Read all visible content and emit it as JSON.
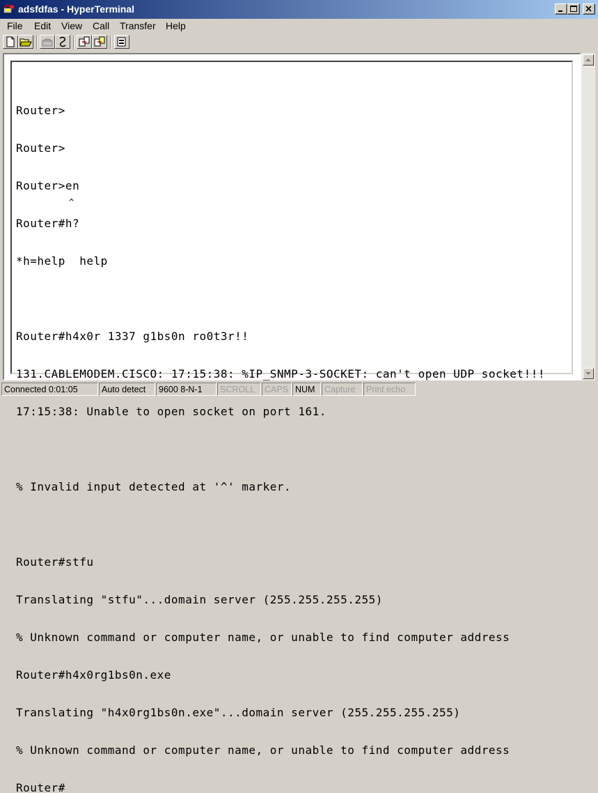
{
  "window": {
    "title": "adsfdfas - HyperTerminal",
    "accent_color": "#0a246a",
    "buttons": [
      "minimize-icon",
      "restore-icon",
      "close-icon"
    ]
  },
  "menu": [
    "File",
    "Edit",
    "View",
    "Call",
    "Transfer",
    "Help"
  ],
  "toolbar": [
    "new-document-icon",
    "open-folder-icon",
    "phone-dial-icon",
    "disconnect-icon",
    "send-file-icon",
    "receive-file-icon",
    "properties-icon"
  ],
  "terminal": {
    "lines": [
      "Router>",
      "Router>",
      "Router>en",
      "Router#h?",
      "*h=help  help",
      "",
      "Router#h4x0r 1337 g1bs0n ro0t3r!!",
      "131.CABLEMODEM.CISCO: 17:15:38: %IP_SNMP-3-SOCKET: can't open UDP socket!!!",
      "17:15:38: Unable to open socket on port 161.",
      "",
      "% Invalid input detected at '^' marker.",
      "",
      "Router#stfu",
      "Translating \"stfu\"...domain server (255.255.255.255)",
      "% Unknown command or computer name, or unable to find computer address",
      "Router#h4x0rg1bs0n.exe",
      "Translating \"h4x0rg1bs0n.exe\"...domain server (255.255.255.255)",
      "% Unknown command or computer name, or unable to find computer address",
      "Router#"
    ],
    "caret": "^"
  },
  "status": {
    "connected": "Connected 0:01:05",
    "detect": "Auto detect",
    "settings": "9600 8-N-1",
    "scroll": "SCROLL",
    "caps": "CAPS",
    "num": "NUM",
    "capture": "Capture",
    "print_echo": "Print echo"
  }
}
